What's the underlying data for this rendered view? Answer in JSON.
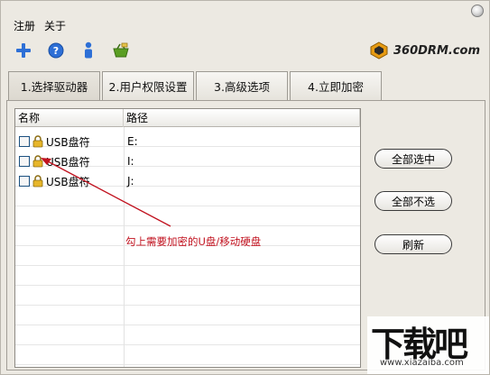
{
  "menu": {
    "items": [
      "注册",
      "关于"
    ]
  },
  "toolbar": {
    "icons": [
      "plus-icon",
      "help-icon",
      "user-icon",
      "basket-icon"
    ],
    "colors": {
      "plus": "#2d6fd6",
      "help": "#2d6fd6",
      "user": "#2d6fd6",
      "basket": "#5a9e22"
    }
  },
  "brand": {
    "text": "360DRM.com",
    "logo_color": "#e79b12"
  },
  "tabs": [
    {
      "label": "1.选择驱动器",
      "active": true
    },
    {
      "label": "2.用户权限设置",
      "active": false
    },
    {
      "label": "3.高级选项",
      "active": false
    },
    {
      "label": "4.立即加密",
      "active": false
    }
  ],
  "list": {
    "columns": [
      "名称",
      "路径"
    ],
    "rows": [
      {
        "name": "USB盘符",
        "path": "E:",
        "checked": false
      },
      {
        "name": "USB盘符",
        "path": "I:",
        "checked": false
      },
      {
        "name": "USB盘符",
        "path": "J:",
        "checked": false
      }
    ]
  },
  "buttons": {
    "select_all": "全部选中",
    "deselect_all": "全部不选",
    "refresh": "刷新"
  },
  "annotation": {
    "text": "勾上需要加密的U盘/移动硬盘",
    "color": "#c1121f"
  },
  "watermark": {
    "big": "下载吧",
    "small": "www.xiazaiba.com"
  }
}
